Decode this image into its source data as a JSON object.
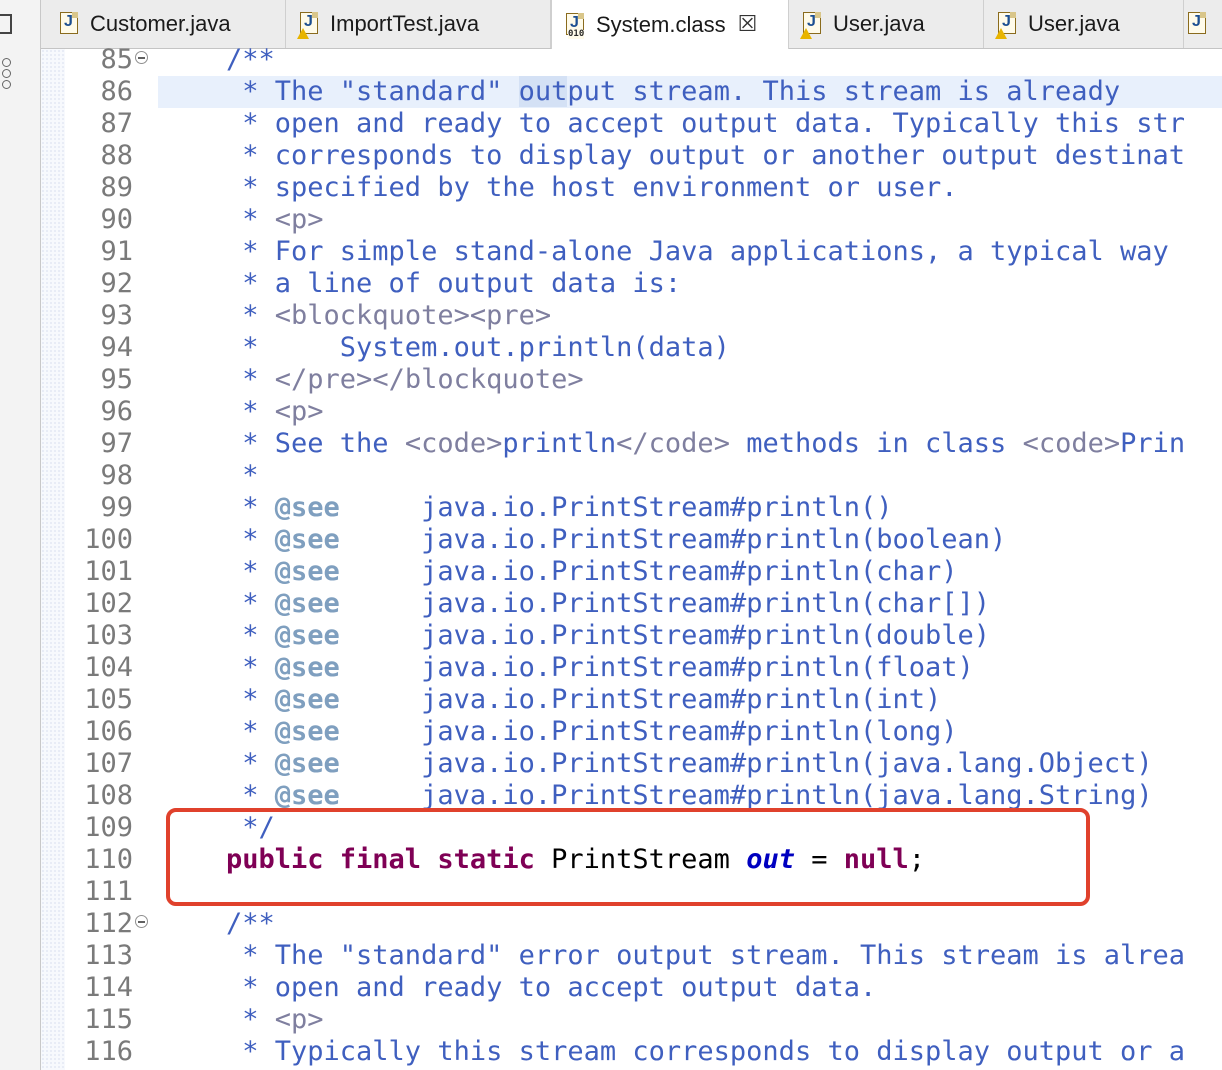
{
  "tabs": [
    {
      "label": "Customer.java",
      "icon": "java-file-icon",
      "warning": false,
      "active": false
    },
    {
      "label": "ImportTest.java",
      "icon": "java-file-icon",
      "warning": true,
      "active": false
    },
    {
      "label": "System.class",
      "icon": "class-file-icon",
      "warning": false,
      "active": true,
      "closable": true
    },
    {
      "label": "User.java",
      "icon": "java-file-icon",
      "warning": true,
      "active": false
    },
    {
      "label": "User.java",
      "icon": "java-file-icon",
      "warning": true,
      "active": false
    }
  ],
  "tab_close_glyph": "☒",
  "gutter": {
    "fold_lines": [
      85,
      112
    ],
    "highlighted_line": 86
  },
  "lines": [
    {
      "n": "85",
      "t": [
        {
          "c": "doc",
          "s": "/**"
        }
      ]
    },
    {
      "n": "86",
      "t": [
        {
          "c": "doc",
          "s": " * The \"standard\" "
        },
        {
          "c": "doc selw",
          "s": "out"
        },
        {
          "c": "doc",
          "s": "put stream. This stream is already"
        }
      ]
    },
    {
      "n": "87",
      "t": [
        {
          "c": "doc",
          "s": " * open and ready to accept output data. Typically this str"
        }
      ]
    },
    {
      "n": "88",
      "t": [
        {
          "c": "doc",
          "s": " * corresponds to display output or another output destinat"
        }
      ]
    },
    {
      "n": "89",
      "t": [
        {
          "c": "doc",
          "s": " * specified by the host environment or user."
        }
      ]
    },
    {
      "n": "90",
      "t": [
        {
          "c": "doc",
          "s": " * "
        },
        {
          "c": "tag",
          "s": "<p>"
        }
      ]
    },
    {
      "n": "91",
      "t": [
        {
          "c": "doc",
          "s": " * For simple stand-alone Java applications, a typical way "
        }
      ]
    },
    {
      "n": "92",
      "t": [
        {
          "c": "doc",
          "s": " * a line of output data is:"
        }
      ]
    },
    {
      "n": "93",
      "t": [
        {
          "c": "doc",
          "s": " * "
        },
        {
          "c": "tag",
          "s": "<blockquote><pre>"
        }
      ]
    },
    {
      "n": "94",
      "t": [
        {
          "c": "doc",
          "s": " *     System.out.println(data)"
        }
      ]
    },
    {
      "n": "95",
      "t": [
        {
          "c": "doc",
          "s": " * "
        },
        {
          "c": "tag",
          "s": "</pre></blockquote>"
        }
      ]
    },
    {
      "n": "96",
      "t": [
        {
          "c": "doc",
          "s": " * "
        },
        {
          "c": "tag",
          "s": "<p>"
        }
      ]
    },
    {
      "n": "97",
      "t": [
        {
          "c": "doc",
          "s": " * See the "
        },
        {
          "c": "tag",
          "s": "<code>"
        },
        {
          "c": "doc",
          "s": "println"
        },
        {
          "c": "tag",
          "s": "</code>"
        },
        {
          "c": "doc",
          "s": " methods in class "
        },
        {
          "c": "tag",
          "s": "<code>"
        },
        {
          "c": "doc",
          "s": "Prin"
        }
      ]
    },
    {
      "n": "98",
      "t": [
        {
          "c": "doc",
          "s": " *"
        }
      ]
    },
    {
      "n": "99",
      "t": [
        {
          "c": "doc",
          "s": " * "
        },
        {
          "c": "see",
          "s": "@see"
        },
        {
          "c": "doc",
          "s": "     java.io.PrintStream#println()"
        }
      ]
    },
    {
      "n": "100",
      "t": [
        {
          "c": "doc",
          "s": " * "
        },
        {
          "c": "see",
          "s": "@see"
        },
        {
          "c": "doc",
          "s": "     java.io.PrintStream#println(boolean)"
        }
      ]
    },
    {
      "n": "101",
      "t": [
        {
          "c": "doc",
          "s": " * "
        },
        {
          "c": "see",
          "s": "@see"
        },
        {
          "c": "doc",
          "s": "     java.io.PrintStream#println(char)"
        }
      ]
    },
    {
      "n": "102",
      "t": [
        {
          "c": "doc",
          "s": " * "
        },
        {
          "c": "see",
          "s": "@see"
        },
        {
          "c": "doc",
          "s": "     java.io.PrintStream#println(char[])"
        }
      ]
    },
    {
      "n": "103",
      "t": [
        {
          "c": "doc",
          "s": " * "
        },
        {
          "c": "see",
          "s": "@see"
        },
        {
          "c": "doc",
          "s": "     java.io.PrintStream#println(double)"
        }
      ]
    },
    {
      "n": "104",
      "t": [
        {
          "c": "doc",
          "s": " * "
        },
        {
          "c": "see",
          "s": "@see"
        },
        {
          "c": "doc",
          "s": "     java.io.PrintStream#println(float)"
        }
      ]
    },
    {
      "n": "105",
      "t": [
        {
          "c": "doc",
          "s": " * "
        },
        {
          "c": "see",
          "s": "@see"
        },
        {
          "c": "doc",
          "s": "     java.io.PrintStream#println(int)"
        }
      ]
    },
    {
      "n": "106",
      "t": [
        {
          "c": "doc",
          "s": " * "
        },
        {
          "c": "see",
          "s": "@see"
        },
        {
          "c": "doc",
          "s": "     java.io.PrintStream#println(long)"
        }
      ]
    },
    {
      "n": "107",
      "t": [
        {
          "c": "doc",
          "s": " * "
        },
        {
          "c": "see",
          "s": "@see"
        },
        {
          "c": "doc",
          "s": "     java.io.PrintStream#println(java.lang.Object)"
        }
      ]
    },
    {
      "n": "108",
      "t": [
        {
          "c": "doc",
          "s": " * "
        },
        {
          "c": "see",
          "s": "@see"
        },
        {
          "c": "doc",
          "s": "     java.io.PrintStream#println(java.lang.String)"
        }
      ]
    },
    {
      "n": "109",
      "t": [
        {
          "c": "doc",
          "s": " */"
        }
      ]
    },
    {
      "n": "110",
      "t": [
        {
          "c": "kw",
          "s": "public final static"
        },
        {
          "c": "plain",
          "s": " PrintStream "
        },
        {
          "c": "fld",
          "s": "out"
        },
        {
          "c": "plain",
          "s": " = "
        },
        {
          "c": "kw",
          "s": "null"
        },
        {
          "c": "plain",
          "s": ";"
        }
      ]
    },
    {
      "n": "111",
      "t": []
    },
    {
      "n": "112",
      "t": [
        {
          "c": "doc",
          "s": "/**"
        }
      ]
    },
    {
      "n": "113",
      "t": [
        {
          "c": "doc",
          "s": " * The \"standard\" error output stream. This stream is alrea"
        }
      ]
    },
    {
      "n": "114",
      "t": [
        {
          "c": "doc",
          "s": " * open and ready to accept output data."
        }
      ]
    },
    {
      "n": "115",
      "t": [
        {
          "c": "doc",
          "s": " * "
        },
        {
          "c": "tag",
          "s": "<p>"
        }
      ]
    },
    {
      "n": "116",
      "t": [
        {
          "c": "doc",
          "s": " * Typically this stream corresponds to display output or a"
        }
      ]
    }
  ],
  "colors": {
    "javadoc": "#3f5fbf",
    "keyword": "#7f0055",
    "field": "#0000c0",
    "annotation_box": "#e0412c"
  }
}
